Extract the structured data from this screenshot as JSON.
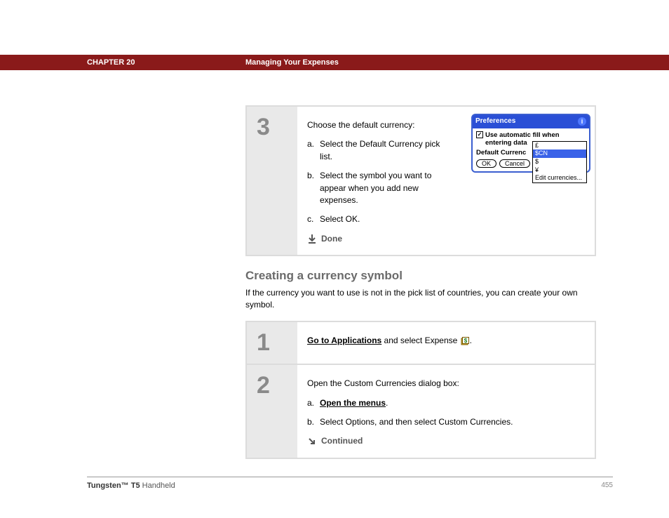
{
  "header": {
    "chapter": "CHAPTER 20",
    "section": "Managing Your Expenses"
  },
  "step3": {
    "num": "3",
    "intro": "Choose the default currency:",
    "a": {
      "lt": "a.",
      "txt": "Select the Default Currency pick list."
    },
    "b": {
      "lt": "b.",
      "txt": "Select the symbol you want to appear when you add new expenses."
    },
    "c": {
      "lt": "c.",
      "txt": "Select OK."
    },
    "done": "Done"
  },
  "device": {
    "title": "Preferences",
    "check_label": "Use automatic fill when entering data",
    "row_label": "Default Currenc",
    "ok": "OK",
    "cancel": "Cancel",
    "opts": {
      "o1": "£",
      "o2": "$CN",
      "o3": "$",
      "o4": "¥",
      "o5": "Edit currencies..."
    }
  },
  "section2": {
    "heading": "Creating a currency symbol",
    "para": "If the currency you want to use is not in the pick list of countries, you can create your own symbol."
  },
  "step1": {
    "num": "1",
    "link": "Go to Applications",
    "rest": " and select Expense ",
    "period": "."
  },
  "step2": {
    "num": "2",
    "intro": "Open the Custom Currencies dialog box:",
    "a": {
      "lt": "a.",
      "link": "Open the menus",
      "period": "."
    },
    "b": {
      "lt": "b.",
      "txt": "Select Options, and then select Custom Currencies."
    },
    "cont": "Continued"
  },
  "footer": {
    "brand": "Tungsten™",
    "model": " T5",
    "suffix": " Handheld",
    "page": "455"
  }
}
